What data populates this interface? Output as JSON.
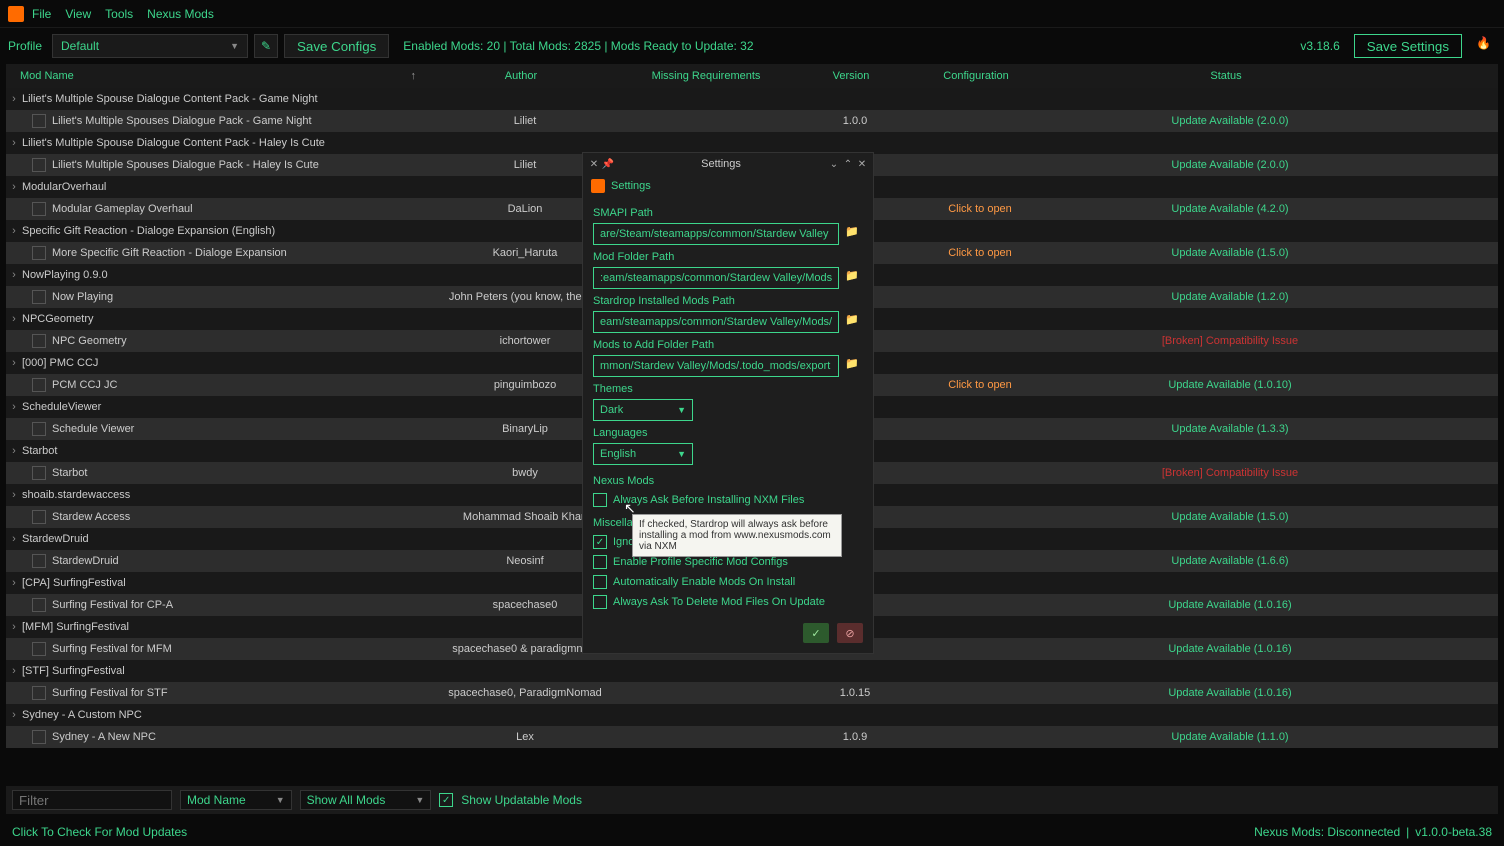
{
  "menubar": {
    "items": [
      "File",
      "View",
      "Tools",
      "Nexus Mods"
    ]
  },
  "profilebar": {
    "label": "Profile",
    "selected": "Default",
    "save_configs": "Save Configs",
    "status": "Enabled Mods: 20 | Total Mods: 2825 | Mods Ready to Update: 32",
    "version": "v3.18.6",
    "save_settings": "Save Settings"
  },
  "columns": {
    "name": "Mod Name",
    "author": "Author",
    "req": "Missing Requirements",
    "ver": "Version",
    "conf": "Configuration",
    "status": "Status"
  },
  "rows": [
    {
      "t": "p",
      "name": "Liliet's Multiple Spouse Dialogue Content Pack - Game Night"
    },
    {
      "t": "c",
      "name": "Liliet's Multiple Spouses Dialogue Pack - Game Night",
      "author": "Liliet",
      "ver": "1.0.0",
      "status": "Update Available (2.0.0)",
      "sc": "update"
    },
    {
      "t": "p",
      "name": "Liliet's Multiple Spouse Dialogue Content Pack - Haley Is Cute"
    },
    {
      "t": "c",
      "name": "Liliet's Multiple Spouses Dialogue Pack - Haley Is Cute",
      "author": "Liliet",
      "status": "Update Available (2.0.0)",
      "sc": "update"
    },
    {
      "t": "p",
      "name": "ModularOverhaul"
    },
    {
      "t": "c",
      "name": "Modular Gameplay Overhaul",
      "author": "DaLion",
      "conf": "Click to open",
      "status": "Update Available (4.2.0)",
      "sc": "update"
    },
    {
      "t": "p",
      "name": "Specific Gift Reaction - Dialoge Expansion (English)"
    },
    {
      "t": "c",
      "name": "More Specific Gift Reaction - Dialoge Expansion",
      "author": "Kaori_Haruta",
      "conf": "Click to open",
      "status": "Update Available (1.5.0)",
      "sc": "update"
    },
    {
      "t": "p",
      "name": "NowPlaying 0.9.0"
    },
    {
      "t": "c",
      "name": "Now Playing",
      "author": "John Peters (you know, the farr",
      "status": "Update Available (1.2.0)",
      "sc": "update"
    },
    {
      "t": "p",
      "name": "NPCGeometry"
    },
    {
      "t": "c",
      "name": "NPC Geometry",
      "author": "ichortower",
      "status": "[Broken] Compatibility Issue",
      "sc": "broken"
    },
    {
      "t": "p",
      "name": "[000] PMC CCJ"
    },
    {
      "t": "c",
      "name": "PCM CCJ JC",
      "author": "pinguimbozo",
      "conf": "Click to open",
      "status": "Update Available (1.0.10)",
      "sc": "update"
    },
    {
      "t": "p",
      "name": "ScheduleViewer"
    },
    {
      "t": "c",
      "name": "Schedule Viewer",
      "author": "BinaryLip",
      "status": "Update Available (1.3.3)",
      "sc": "update"
    },
    {
      "t": "p",
      "name": "Starbot"
    },
    {
      "t": "c",
      "name": "Starbot",
      "author": "bwdy",
      "status": "[Broken] Compatibility Issue",
      "sc": "broken"
    },
    {
      "t": "p",
      "name": "shoaib.stardewaccess"
    },
    {
      "t": "c",
      "name": "Stardew Access",
      "author": "Mohammad Shoaib Khan",
      "status": "Update Available (1.5.0)",
      "sc": "update"
    },
    {
      "t": "p",
      "name": "StardewDruid"
    },
    {
      "t": "c",
      "name": "StardewDruid",
      "author": "Neosinf",
      "status": "Update Available (1.6.6)",
      "sc": "update"
    },
    {
      "t": "p",
      "name": "[CPA] SurfingFestival"
    },
    {
      "t": "c",
      "name": "Surfing Festival for CP-A",
      "author": "spacechase0",
      "status": "Update Available (1.0.16)",
      "sc": "update"
    },
    {
      "t": "p",
      "name": "[MFM] SurfingFestival"
    },
    {
      "t": "c",
      "name": "Surfing Festival for MFM",
      "author": "spacechase0 & paradigmnom",
      "status": "Update Available (1.0.16)",
      "sc": "update"
    },
    {
      "t": "p",
      "name": "[STF] SurfingFestival"
    },
    {
      "t": "c",
      "name": "Surfing Festival for STF",
      "author": "spacechase0, ParadigmNomad",
      "ver": "1.0.15",
      "status": "Update Available (1.0.16)",
      "sc": "update"
    },
    {
      "t": "p",
      "name": "Sydney - A Custom NPC"
    },
    {
      "t": "c",
      "name": "Sydney - A New NPC",
      "author": "Lex",
      "ver": "1.0.9",
      "status": "Update Available (1.1.0)",
      "sc": "update"
    }
  ],
  "footer": {
    "filter_placeholder": "Filter",
    "sort_by": "Mod Name",
    "show_filter": "Show All Mods",
    "show_updatable": "Show Updatable Mods"
  },
  "statusbar": {
    "check_updates": "Click To Check For Mod Updates",
    "nexus": "Nexus Mods: Disconnected",
    "appver": "v1.0.0-beta.38"
  },
  "settings": {
    "title": "Settings",
    "heading": "Settings",
    "smapi_label": "SMAPI Path",
    "smapi_value": "are/Steam/steamapps/common/Stardew Valley",
    "modfolder_label": "Mod Folder Path",
    "modfolder_value": ":eam/steamapps/common/Stardew Valley/Mods",
    "installed_label": "Stardrop Installed Mods Path",
    "installed_value": "eam/steamapps/common/Stardew Valley/Mods/",
    "addfolder_label": "Mods to Add Folder Path",
    "addfolder_value": "mmon/Stardew Valley/Mods/.todo_mods/export",
    "themes_label": "Themes",
    "themes_value": "Dark",
    "lang_label": "Languages",
    "lang_value": "English",
    "nexus_section": "Nexus Mods",
    "always_ask_nxm": "Always Ask Before Installing NXM Files",
    "misc_section": "Miscellar",
    "ignore_hidden": "Ignore Hidden Folders",
    "enable_profile": "Enable Profile Specific Mod Configs",
    "auto_enable": "Automatically Enable Mods On Install",
    "always_delete": "Always Ask To Delete Mod Files On Update"
  },
  "tooltip": "If checked, Stardrop will always ask before installing a mod from www.nexusmods.com via NXM"
}
